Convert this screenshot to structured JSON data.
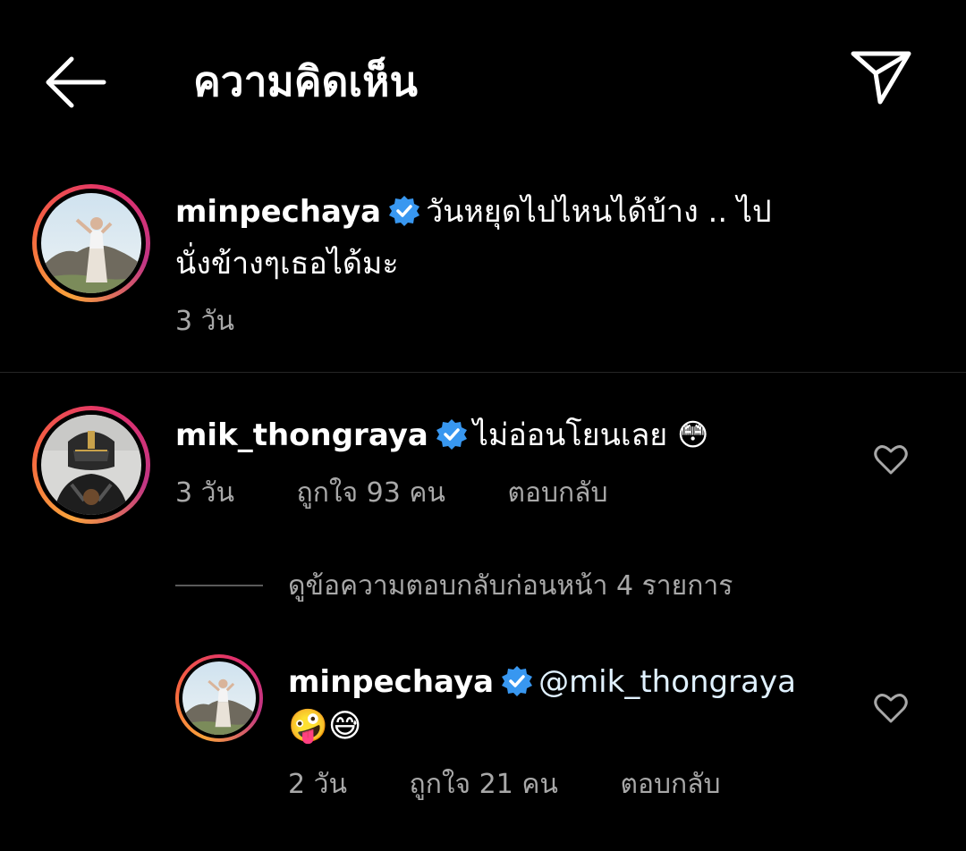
{
  "header": {
    "title": "ความคิดเห็น"
  },
  "icons": {
    "back": "arrow-left-icon",
    "send": "paper-plane-icon",
    "verified": "verified-badge-icon",
    "like": "heart-outline-icon"
  },
  "colors": {
    "background": "#000000",
    "muted": "#a8a8a8",
    "mention": "#e0f1ff",
    "verified": "#3897f0"
  },
  "caption": {
    "username": "minpechaya",
    "text_line1": "วันหยุดไปไหนได้บ้าง .. ไป",
    "text_line2": "นั่งข้างๆเธอได้มะ",
    "time": "3 วัน"
  },
  "comment": {
    "username": "mik_thongraya",
    "text": "ไม่อ่อนโยนเลย 😳",
    "time": "3 วัน",
    "likes": "ถูกใจ 93 คน",
    "reply_label": "ตอบกลับ"
  },
  "view_replies": "ดูข้อความตอบกลับก่อนหน้า 4 รายการ",
  "reply": {
    "username": "minpechaya",
    "mention": "@mik_thongraya",
    "emojis": "🤪😅",
    "time": "2 วัน",
    "likes": "ถูกใจ 21 คน",
    "reply_label": "ตอบกลับ"
  }
}
